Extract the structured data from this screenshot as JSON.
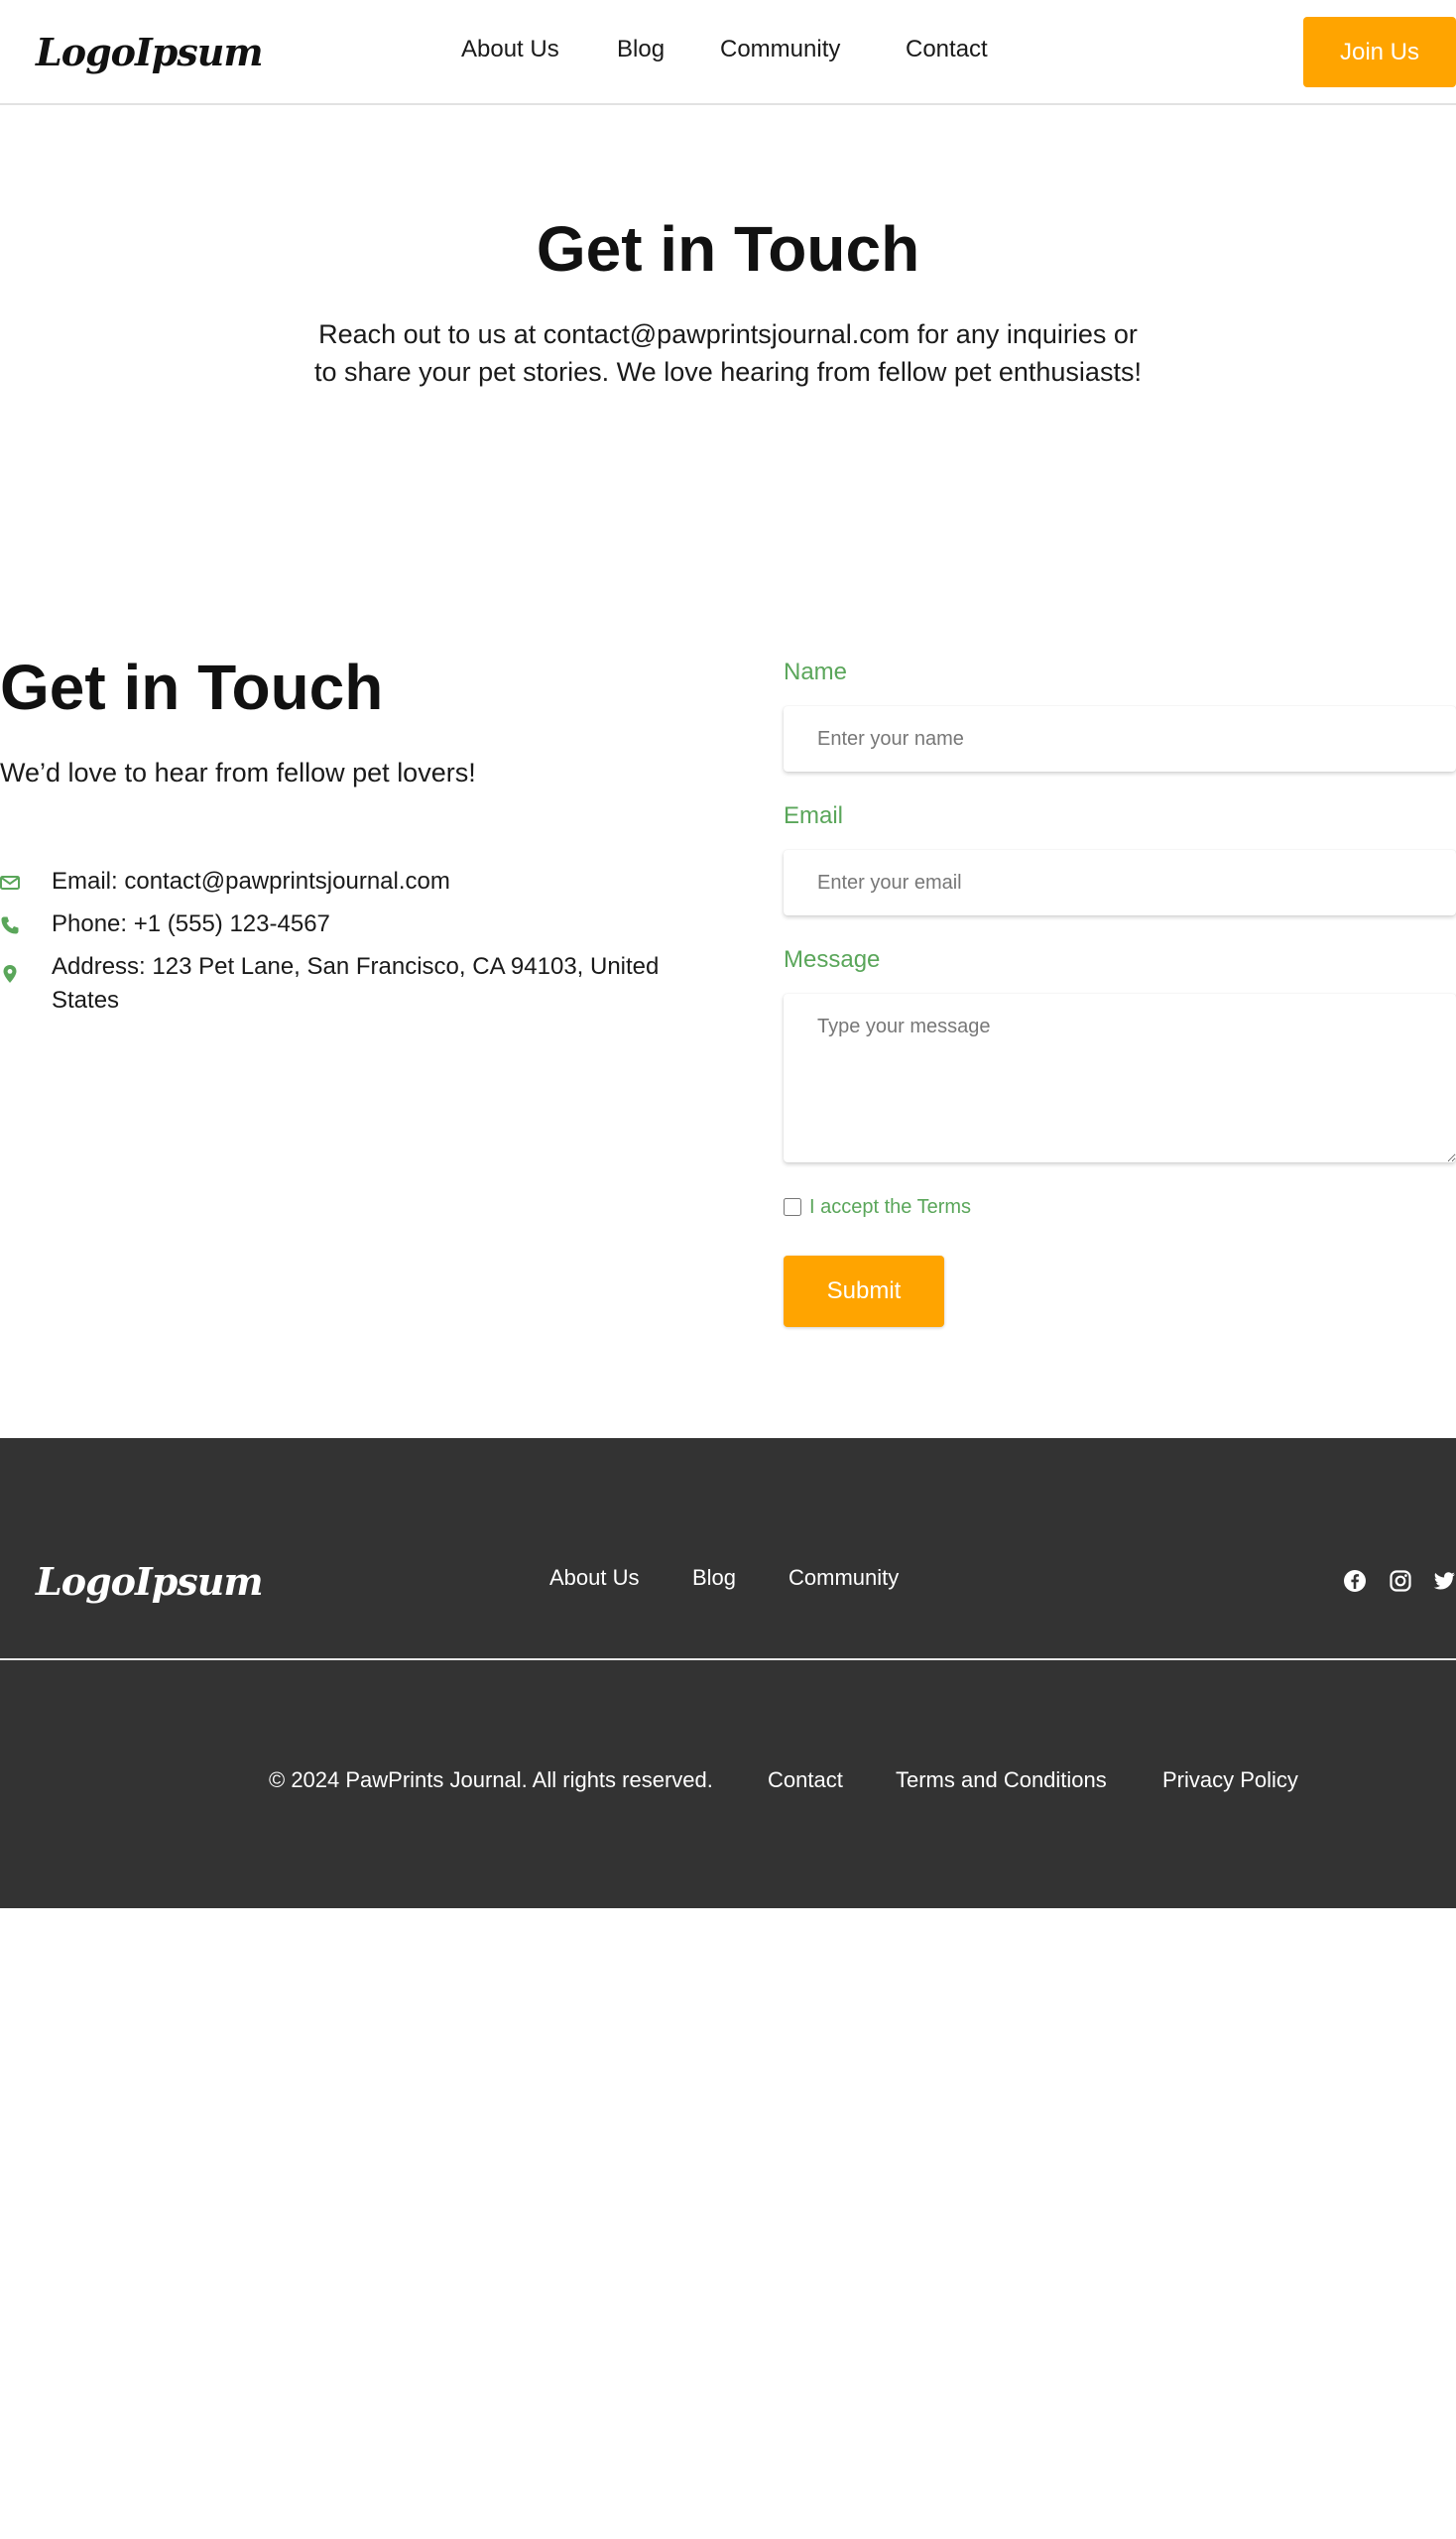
{
  "header": {
    "logo": "LogoIpsum",
    "nav": [
      "About Us",
      "Blog",
      "Community",
      "Contact"
    ],
    "join_label": "Join Us"
  },
  "hero": {
    "title": "Get in Touch",
    "text": "Reach out to us at contact@pawprintsjournal.com for any inquiries or to share your pet stories. We love hearing from fellow pet enthusiasts!"
  },
  "contact": {
    "title": "Get in Touch",
    "subtitle": "We’d love to hear from fellow pet lovers!",
    "email": "Email: contact@pawprintsjournal.com",
    "phone": "Phone: +1 (555) 123-4567",
    "address": "Address: 123 Pet Lane, San Francisco, CA 94103, United States",
    "icons": [
      "envelope-icon",
      "phone-icon",
      "map-pin-icon"
    ]
  },
  "form": {
    "name_label": "Name",
    "name_placeholder": "Enter your name",
    "email_label": "Email",
    "email_placeholder": "Enter your email",
    "message_label": "Message",
    "message_placeholder": "Type your message",
    "terms_label": "I accept the Terms",
    "submit_label": "Submit"
  },
  "footer": {
    "logo": "LogoIpsum",
    "nav": [
      "About Us",
      "Blog",
      "Community"
    ],
    "social_icons": [
      "facebook-icon",
      "instagram-icon",
      "twitter-icon"
    ],
    "copyright": "© 2024 PawPrints Journal. All rights reserved.",
    "links": [
      "Contact",
      "Terms and Conditions",
      "Privacy Policy"
    ]
  },
  "colors": {
    "accent": "#ffa400",
    "green": "#5aa65a",
    "footer_bg": "#333333"
  }
}
